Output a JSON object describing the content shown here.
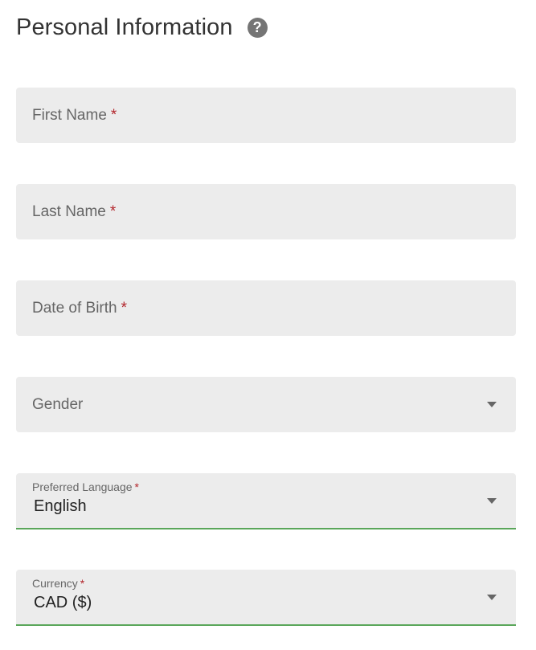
{
  "section": {
    "title": "Personal Information",
    "help_icon": "question-circle-icon",
    "help_glyph": "?"
  },
  "fields": {
    "first_name": {
      "label": "First Name",
      "required_mark": "*"
    },
    "last_name": {
      "label": "Last Name",
      "required_mark": "*"
    },
    "date_of_birth": {
      "label": "Date of Birth",
      "required_mark": "*"
    },
    "gender": {
      "label": "Gender"
    },
    "preferred_language": {
      "label": "Preferred Language",
      "required_mark": "*",
      "value": "English"
    },
    "currency": {
      "label": "Currency",
      "required_mark": "*",
      "value": "CAD ($)"
    }
  },
  "colors": {
    "field_background": "#ececec",
    "required_mark": "#b3262c",
    "active_underline": "#5aa65a",
    "help_icon_background": "#757575"
  }
}
